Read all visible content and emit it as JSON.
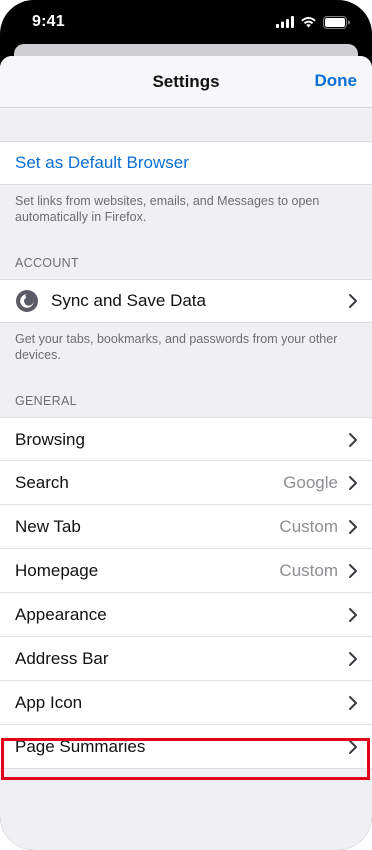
{
  "status_bar": {
    "time": "9:41",
    "icons": [
      "cellular-signal-icon",
      "wifi-icon",
      "battery-icon"
    ]
  },
  "nav": {
    "title": "Settings",
    "done_label": "Done"
  },
  "default_browser": {
    "label": "Set as Default Browser",
    "footer": "Set links from websites, emails, and Messages to open automatically in Firefox."
  },
  "account": {
    "header": "ACCOUNT",
    "sync_label": "Sync and Save Data",
    "sync_icon": "firefox-account-icon",
    "footer": "Get your tabs, bookmarks, and passwords from your other devices."
  },
  "general": {
    "header": "GENERAL",
    "items": [
      {
        "label": "Browsing",
        "value": ""
      },
      {
        "label": "Search",
        "value": "Google"
      },
      {
        "label": "New Tab",
        "value": "Custom"
      },
      {
        "label": "Homepage",
        "value": "Custom"
      },
      {
        "label": "Appearance",
        "value": ""
      },
      {
        "label": "Address Bar",
        "value": ""
      },
      {
        "label": "App Icon",
        "value": ""
      },
      {
        "label": "Page Summaries",
        "value": "",
        "highlighted": true
      }
    ]
  },
  "colors": {
    "accent": "#0a6fd6",
    "highlight": "#e3001b",
    "grouped_background": "#efeff4"
  }
}
